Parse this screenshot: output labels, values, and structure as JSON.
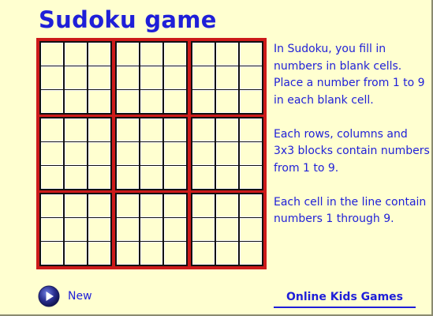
{
  "title": "Sudoku game",
  "board": {
    "size": 9,
    "values": [
      [
        "",
        "",
        "",
        "",
        "",
        "",
        "",
        "",
        ""
      ],
      [
        "",
        "",
        "",
        "",
        "",
        "",
        "",
        "",
        ""
      ],
      [
        "",
        "",
        "",
        "",
        "",
        "",
        "",
        "",
        ""
      ],
      [
        "",
        "",
        "",
        "",
        "",
        "",
        "",
        "",
        ""
      ],
      [
        "",
        "",
        "",
        "",
        "",
        "",
        "",
        "",
        ""
      ],
      [
        "",
        "",
        "",
        "",
        "",
        "",
        "",
        "",
        ""
      ],
      [
        "",
        "",
        "",
        "",
        "",
        "",
        "",
        "",
        ""
      ],
      [
        "",
        "",
        "",
        "",
        "",
        "",
        "",
        "",
        ""
      ],
      [
        "",
        "",
        "",
        "",
        "",
        "",
        "",
        "",
        ""
      ]
    ]
  },
  "instructions": [
    "In Sudoku, you fill in numbers in blank cells. Place a number from 1 to 9 in each blank cell.",
    "Each rows, columns and 3x3 blocks contain numbers from 1 to 9.",
    "Each cell in the line contain numbers 1 through 9."
  ],
  "controls": {
    "new_label": "New",
    "new_icon": "play-icon"
  },
  "footer": {
    "link_label": "Online Kids Games"
  },
  "colors": {
    "background": "#ffffd0",
    "text": "#1f1fd8",
    "board_border": "#cc1a1a",
    "grid_lines": "#111111"
  }
}
